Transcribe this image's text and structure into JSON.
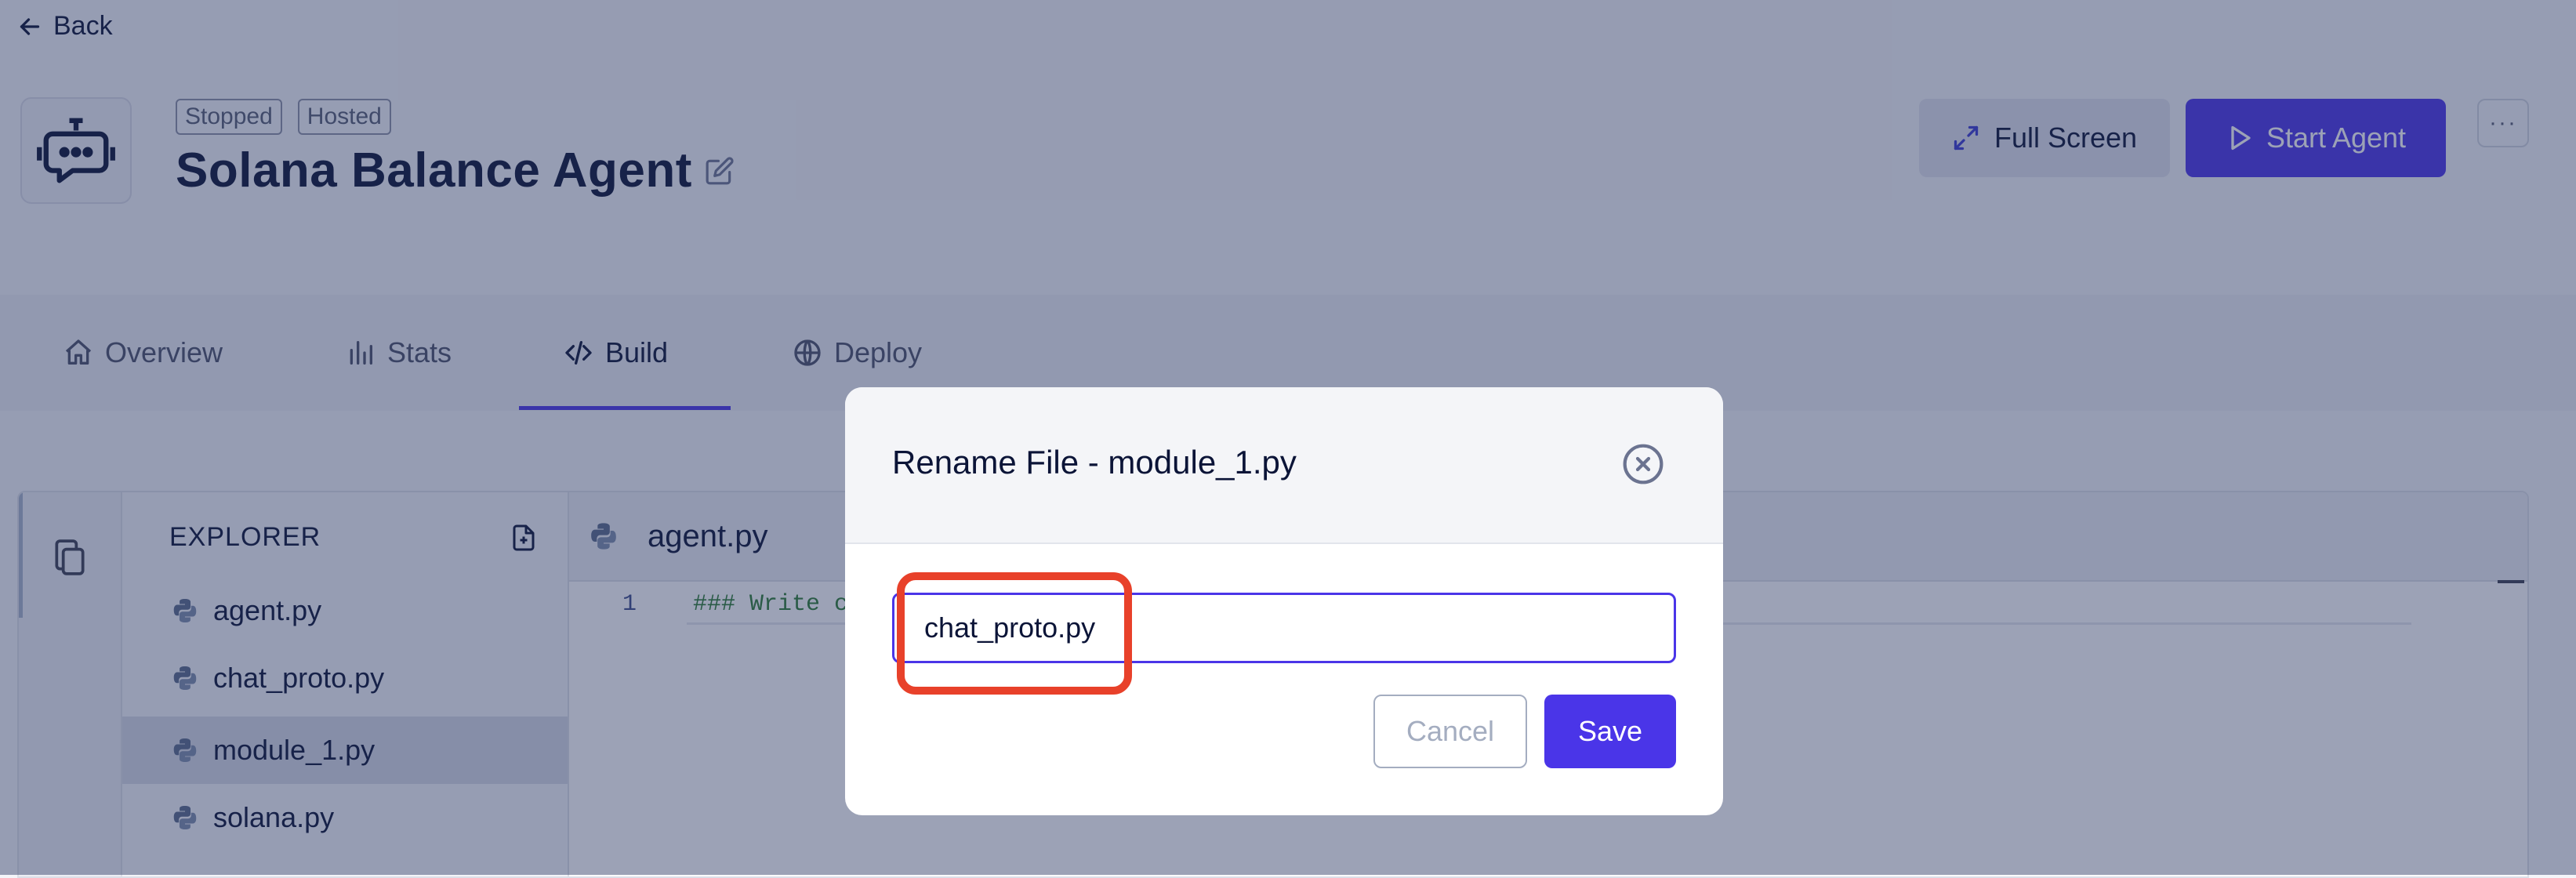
{
  "header": {
    "back_label": "Back",
    "badges": [
      "Stopped",
      "Hosted"
    ],
    "agent_name": "Solana Balance Agent",
    "fullscreen_label": "Full Screen",
    "start_label": "Start Agent",
    "more_label": "···"
  },
  "tabs": [
    {
      "label": "Overview",
      "icon": "home-icon"
    },
    {
      "label": "Stats",
      "icon": "bar-chart-icon"
    },
    {
      "label": "Build",
      "icon": "code-icon",
      "active": true
    },
    {
      "label": "Deploy",
      "icon": "globe-icon"
    }
  ],
  "explorer": {
    "title": "EXPLORER",
    "files": [
      {
        "name": "agent.py"
      },
      {
        "name": "chat_proto.py"
      },
      {
        "name": "module_1.py",
        "selected": true
      },
      {
        "name": "solana.py"
      }
    ]
  },
  "editor": {
    "open_tab": "agent.py",
    "line_number": "1",
    "line_text": "### Write co"
  },
  "modal": {
    "title": "Rename File - module_1.py",
    "input_value": "chat_proto.py",
    "cancel_label": "Cancel",
    "save_label": "Save"
  },
  "colors": {
    "accent": "#4a35e8",
    "highlight": "#e8412a",
    "overlay": "rgba(40,52,95,0.46)"
  }
}
